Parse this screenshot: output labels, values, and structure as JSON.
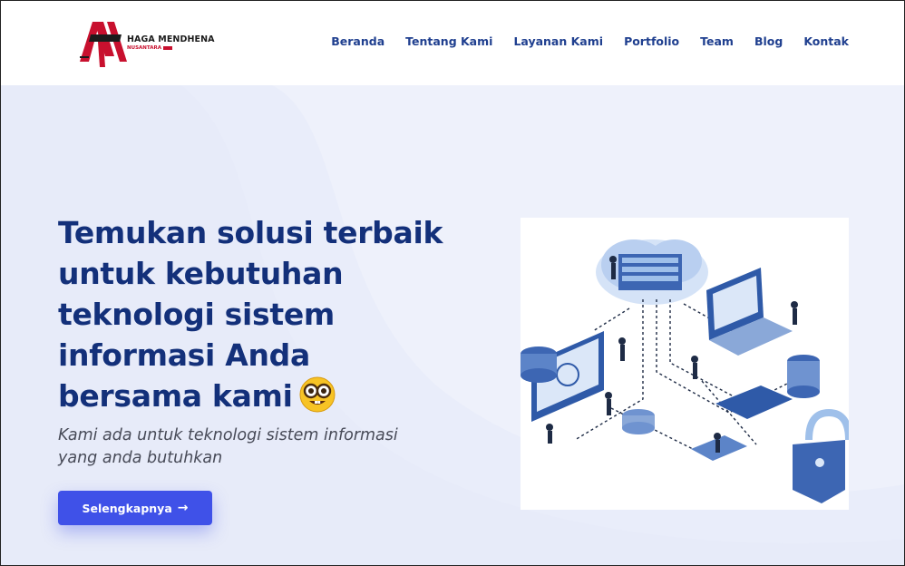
{
  "brand": {
    "name": "HAGA MENDHENA",
    "sub": "NUSANTARA",
    "colors": {
      "red": "#c8102e",
      "dark": "#1b1b1b"
    }
  },
  "nav": {
    "items": [
      {
        "label": "Beranda"
      },
      {
        "label": "Tentang Kami"
      },
      {
        "label": "Layanan Kami"
      },
      {
        "label": "Portfolio"
      },
      {
        "label": "Team"
      },
      {
        "label": "Blog"
      },
      {
        "label": "Kontak"
      }
    ],
    "color": "#1f3f8f"
  },
  "hero": {
    "headline": "Temukan solusi terbaik untuk kebutuhan teknologi sistem informasi Anda bersama kami",
    "emoji_icon": "nerd-face-icon",
    "subtitle": "Kami ada untuk teknologi sistem informasi yang anda butuhkan",
    "cta_label": "Selengkapnya",
    "cta_icon": "arrow-right-icon",
    "colors": {
      "headline": "#13307a",
      "cta": "#3f51e8",
      "background": "#eef1fb"
    },
    "illustration_icon": "isometric-cloud-network-illustration"
  }
}
